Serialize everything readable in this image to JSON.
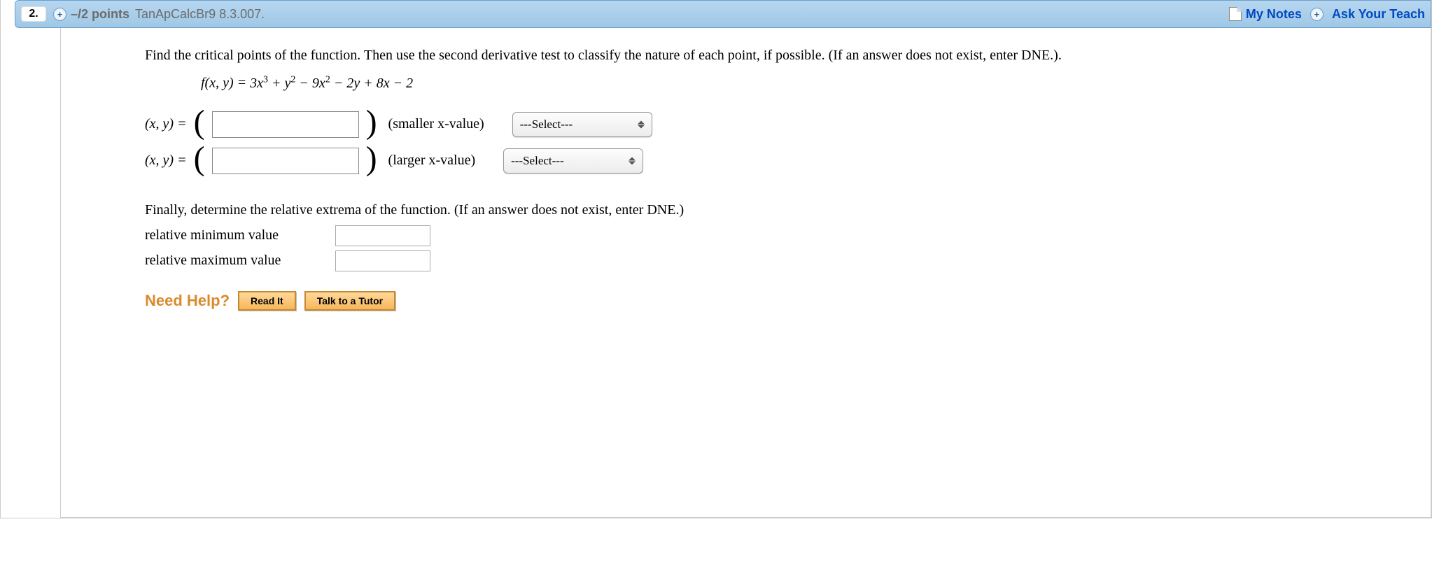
{
  "header": {
    "question_number": "2.",
    "points": "–/2 points",
    "source": "TanApCalcBr9 8.3.007.",
    "my_notes": "My Notes",
    "ask_teacher": "Ask Your Teach"
  },
  "question": {
    "prompt": "Find the critical points of the function. Then use the second derivative test to classify the nature of each point, if possible. (If an answer does not exist, enter DNE.).",
    "function_lhs": "f(x, y) = ",
    "function_rhs_html": "3x³ + y² − 9x² − 2y + 8x − 2",
    "rows": [
      {
        "label": "(x, y) = ",
        "hint": "(smaller x-value)",
        "select": "---Select---"
      },
      {
        "label": "(x, y) = ",
        "hint": "(larger x-value)",
        "select": "---Select---"
      }
    ],
    "extrema_prompt": "Finally, determine the relative extrema of the function. (If an answer does not exist, enter DNE.)",
    "relmin_label": "relative minimum value",
    "relmax_label": "relative maximum value"
  },
  "help": {
    "label": "Need Help?",
    "read": "Read It",
    "tutor": "Talk to a Tutor"
  }
}
